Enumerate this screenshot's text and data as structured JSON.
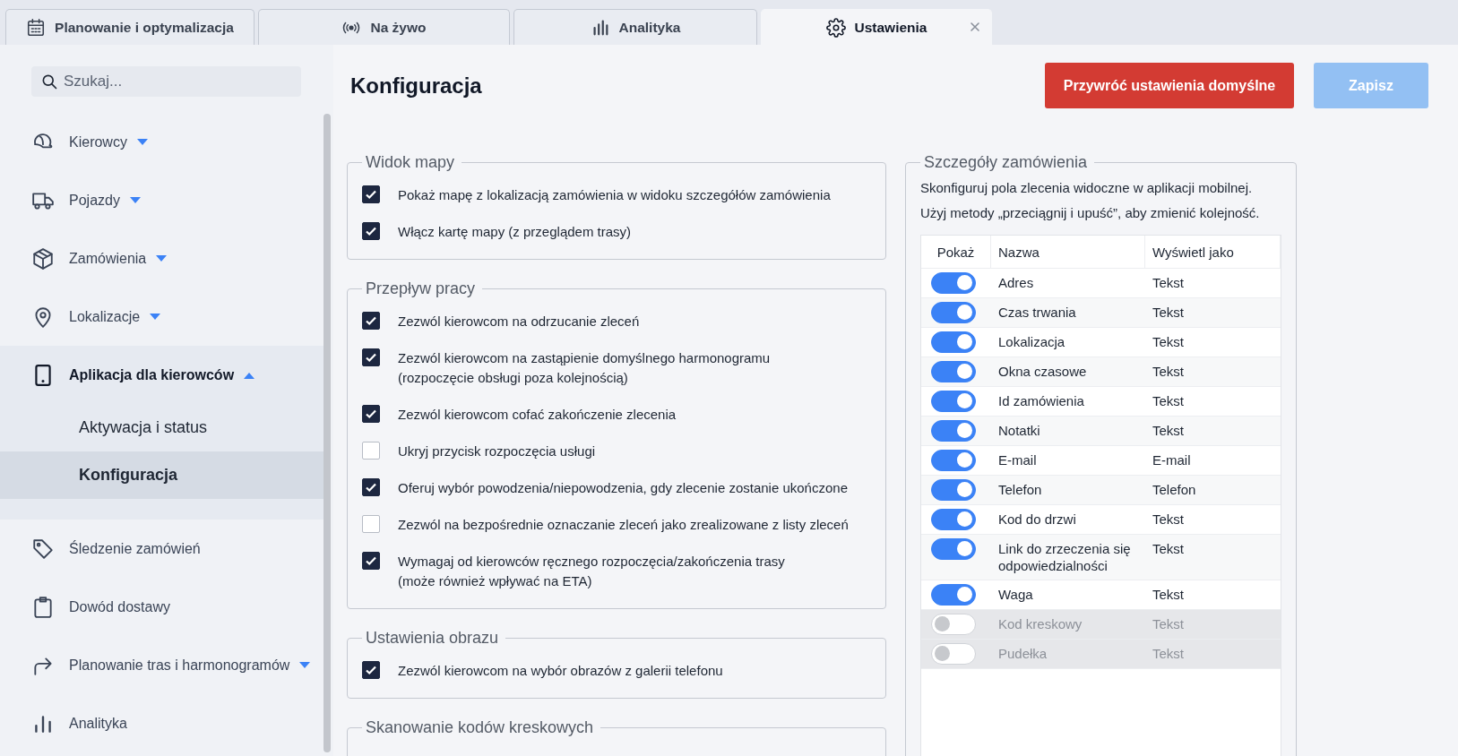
{
  "tabs": [
    {
      "label": "Planowanie i optymalizacja",
      "selected": false
    },
    {
      "label": "Na żywo",
      "selected": false
    },
    {
      "label": "Analityka",
      "selected": false
    },
    {
      "label": "Ustawienia",
      "selected": true
    }
  ],
  "sidebar": {
    "search": {
      "placeholder": "Szukaj..."
    },
    "items": [
      {
        "label": "Kierowcy",
        "expanded": false,
        "selected": false
      },
      {
        "label": "Pojazdy",
        "expanded": false,
        "selected": false
      },
      {
        "label": "Zamówienia",
        "expanded": false,
        "selected": false
      },
      {
        "label": "Lokalizacje",
        "expanded": false,
        "selected": false
      },
      {
        "label": "Aplikacja dla kierowców",
        "expanded": true,
        "selected": false,
        "children": [
          {
            "label": "Aktywacja i status",
            "selected": false
          },
          {
            "label": "Konfiguracja",
            "selected": true
          }
        ]
      },
      {
        "label": "Śledzenie zamówień",
        "selected": false
      },
      {
        "label": "Dowód dostawy",
        "selected": false
      },
      {
        "label": "Planowanie tras i harmonogramów",
        "expanded": false,
        "selected": false
      },
      {
        "label": "Analityka",
        "selected": false
      }
    ]
  },
  "page": {
    "title": "Konfiguracja",
    "buttons": [
      {
        "label": "Przywróć ustawienia domyślne",
        "kind": "danger"
      },
      {
        "label": "Zapisz",
        "kind": "primary",
        "disabled": true
      }
    ]
  },
  "sections": [
    {
      "title": "Widok mapy",
      "options": [
        {
          "label": "Pokaż mapę z lokalizacją zamówienia w widoku szczegółów zamówienia",
          "checked": true
        },
        {
          "label": "Włącz kartę mapy (z przeglądem trasy)",
          "checked": true
        }
      ]
    },
    {
      "title": "Przepływ pracy",
      "options": [
        {
          "label": "Zezwól kierowcom na odrzucanie zleceń",
          "checked": true
        },
        {
          "label": "Zezwól kierowcom na zastąpienie domyślnego harmonogramu\n(rozpoczęcie obsługi poza kolejnością)",
          "checked": true
        },
        {
          "label": "Zezwól kierowcom cofać zakończenie zlecenia",
          "checked": true
        },
        {
          "label": "Ukryj przycisk rozpoczęcia usługi",
          "checked": false
        },
        {
          "label": "Oferuj wybór powodzenia/niepowodzenia, gdy zlecenie zostanie ukończone",
          "checked": true
        },
        {
          "label": "Zezwól na bezpośrednie oznaczanie zleceń jako zrealizowane z listy zleceń",
          "checked": false
        },
        {
          "label": "Wymagaj od kierowców ręcznego rozpoczęcia/zakończenia trasy\n(może również wpływać na ETA)",
          "checked": true
        }
      ]
    },
    {
      "title": "Ustawienia obrazu",
      "options": [
        {
          "label": "Zezwól kierowcom na wybór obrazów z galerii telefonu",
          "checked": true
        }
      ]
    },
    {
      "title": "Skanowanie kodów kreskowych"
    }
  ],
  "order_details": {
    "title": "Szczegóły zamówienia",
    "description": "Skonfiguruj pola zlecenia widoczne w aplikacji mobilnej.\nUżyj metody „przeciągnij i upuść”, aby zmienić kolejność.",
    "columns": [
      "Pokaż",
      "Nazwa",
      "Wyświetl jako"
    ],
    "rows": [
      {
        "on": true,
        "name": "Adres",
        "display": "Tekst"
      },
      {
        "on": true,
        "name": "Czas trwania",
        "display": "Tekst"
      },
      {
        "on": true,
        "name": "Lokalizacja",
        "display": "Tekst"
      },
      {
        "on": true,
        "name": "Okna czasowe",
        "display": "Tekst"
      },
      {
        "on": true,
        "name": "Id zamówienia",
        "display": "Tekst"
      },
      {
        "on": true,
        "name": "Notatki",
        "display": "Tekst"
      },
      {
        "on": true,
        "name": "E-mail",
        "display": "E-mail"
      },
      {
        "on": true,
        "name": "Telefon",
        "display": "Telefon"
      },
      {
        "on": true,
        "name": "Kod do drzwi",
        "display": "Tekst"
      },
      {
        "on": true,
        "name": "Link do zrzeczenia się\nodpowiedzialności",
        "display": "Tekst"
      },
      {
        "on": true,
        "name": "Waga",
        "display": "Tekst"
      },
      {
        "on": false,
        "name": "Kod kreskowy",
        "display": "Tekst"
      },
      {
        "on": false,
        "name": "Pudełka",
        "display": "Tekst"
      }
    ]
  }
}
